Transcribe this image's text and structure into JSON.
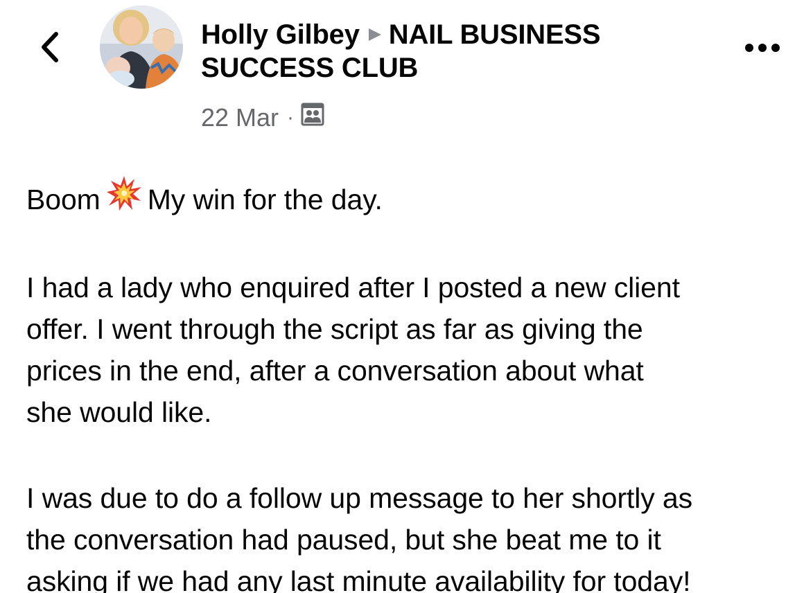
{
  "header": {
    "author": "Holly Gilbey",
    "group": "NAIL BUSINESS SUCCESS CLUB",
    "date": "22 Mar",
    "separator": "·",
    "audience_icon": "group-members-icon"
  },
  "icons": {
    "back": "chevron-left-icon",
    "more": "more-options-icon",
    "arrow": "right-triangle-icon",
    "boom": "collision-emoji-icon"
  },
  "colors": {
    "text": "#050505",
    "secondary_text": "#65676b",
    "arrow": "#8a8d91"
  },
  "post": {
    "line1_before": "Boom",
    "line1_after": "My win for the day.",
    "para2_lines": [
      "I had a lady who enquired after I posted a new client",
      "offer. I went through the script as far as giving the",
      "prices in the end, after a conversation about what",
      "she would like."
    ],
    "para3_lines": [
      "I was due to do a follow up message to her shortly as",
      "the conversation had paused, but she beat me to it",
      "asking if we had any last minute availability for today!"
    ]
  }
}
